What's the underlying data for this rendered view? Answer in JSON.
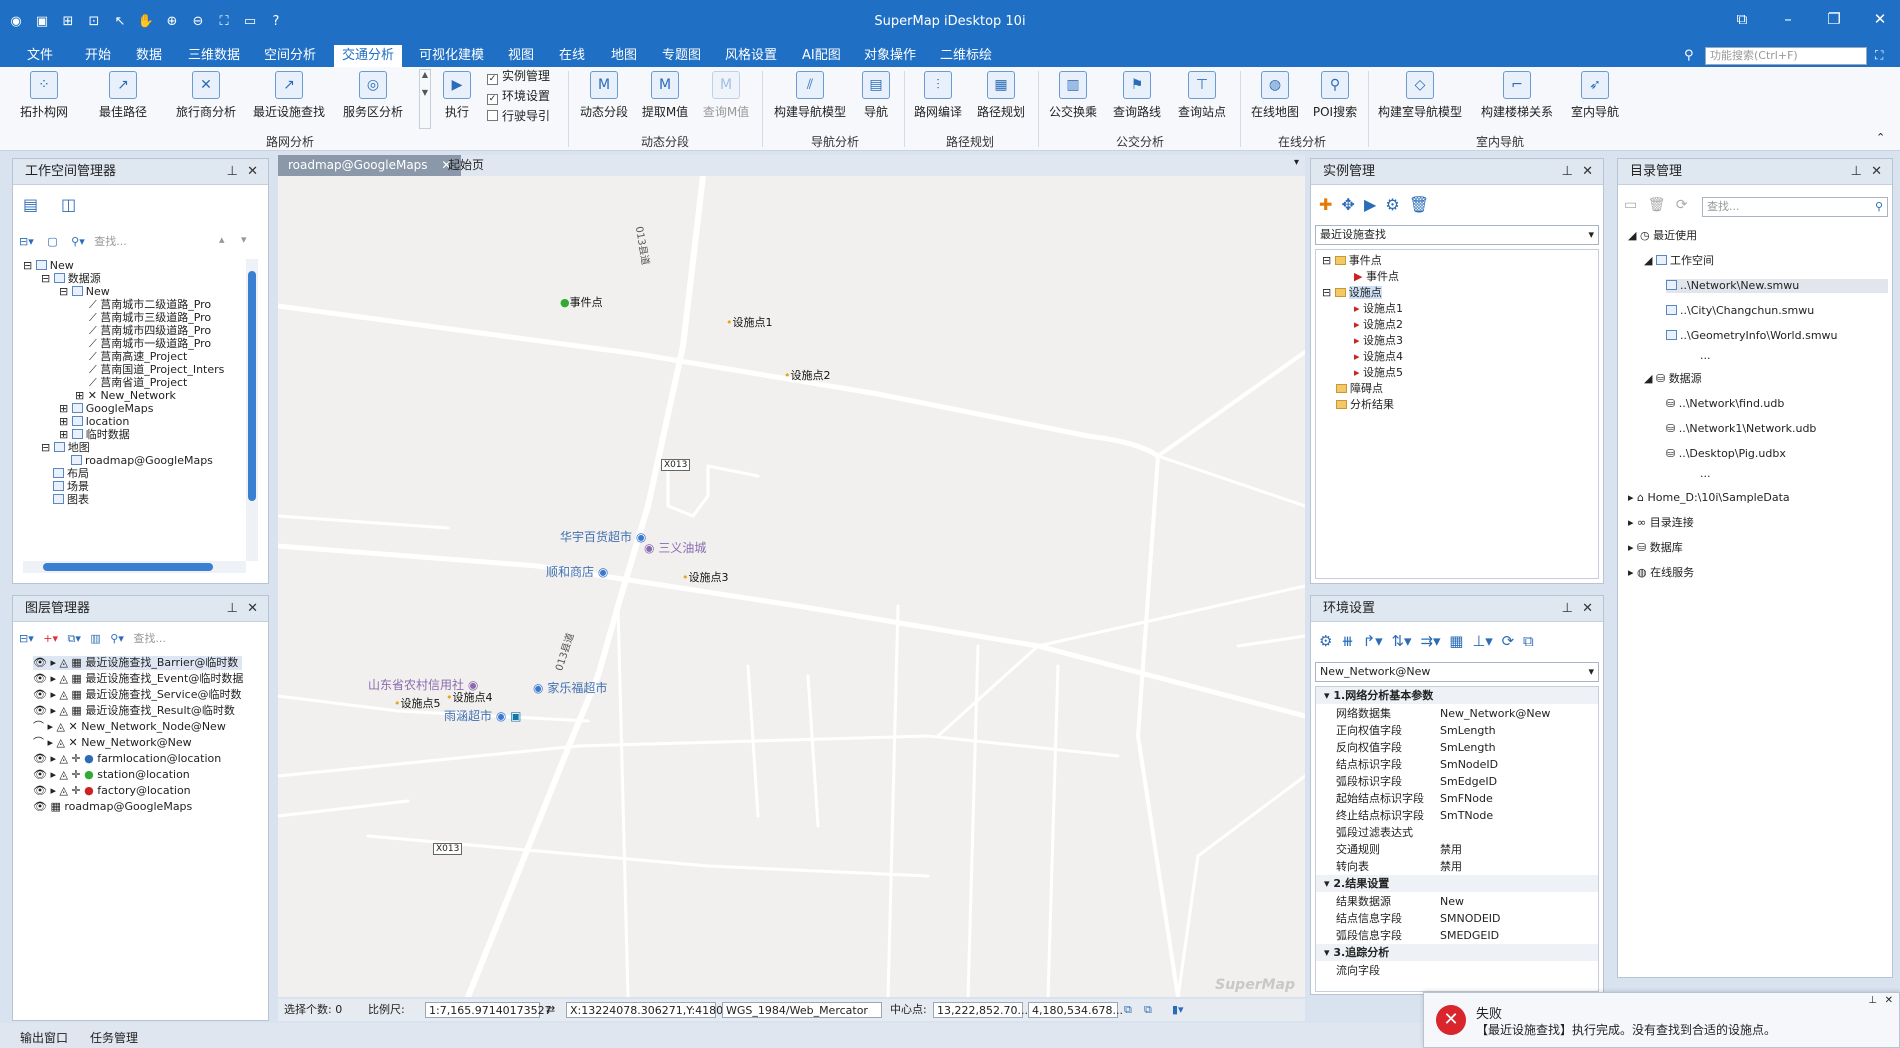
{
  "app": {
    "title": "SuperMap iDesktop 10i"
  },
  "menu": [
    "文件",
    "开始",
    "数据",
    "三维数据",
    "空间分析",
    "交通分析",
    "可视化建模",
    "视图",
    "在线",
    "地图",
    "专题图",
    "风格设置",
    "AI配图",
    "对象操作",
    "二维标绘"
  ],
  "search": {
    "placeholder": "功能搜索(Ctrl+F)"
  },
  "ribbon": {
    "buttons": [
      "拓扑构网",
      "最佳路径",
      "旅行商分析",
      "最近设施查找",
      "服务区分析",
      "执行",
      "动态分段",
      "提取M值",
      "查询M值",
      "构建导航模型",
      "导航",
      "路网编译",
      "路径规划",
      "公交换乘",
      "查询路线",
      "查询站点",
      "在线地图",
      "POI搜索",
      "构建室导航模型",
      "构建楼梯关系",
      "室内导航"
    ],
    "checks": [
      "实例管理",
      "环境设置",
      "行驶导引"
    ],
    "groups": [
      "路网分析",
      "动态分段",
      "导航分析",
      "路径规划",
      "公交分析",
      "在线分析",
      "室内导航"
    ]
  },
  "workspace": {
    "title": "工作空间管理器",
    "search_placeholder": "查找...",
    "items": [
      "New",
      "数据源",
      "New",
      "莒南城市二级道路_Pro",
      "莒南城市三级道路_Pro",
      "莒南城市四级道路_Pro",
      "莒南城市一级道路_Pro",
      "莒南高速_Project",
      "莒南国道_Project_Inters",
      "莒南省道_Project",
      "New_Network",
      "GoogleMaps",
      "location",
      "临时数据",
      "地图",
      "roadmap@GoogleMaps",
      "布局",
      "场景",
      "图表"
    ]
  },
  "layers": {
    "title": "图层管理器",
    "search_placeholder": "查找...",
    "items": [
      "最近设施查找_Barrier@临时数",
      "最近设施查找_Event@临时数据",
      "最近设施查找_Service@临时数",
      "最近设施查找_Result@临时数",
      "New_Network_Node@New",
      "New_Network@New",
      "farmlocation@location",
      "station@location",
      "factory@location",
      "roadmap@GoogleMaps"
    ]
  },
  "tabs": [
    "roadmap@GoogleMaps",
    "起始页"
  ],
  "map": {
    "labels": [
      "事件点",
      "设施点1",
      "设施点2",
      "设施点3",
      "设施点4",
      "设施点5",
      "华宇百货超市",
      "三义油城",
      "顺和商店",
      "山东省农村信用社",
      "家乐福超市",
      "雨涵超市",
      "013县道",
      "013县道",
      "X013",
      "X013"
    ],
    "watermark": "SuperMap"
  },
  "status": {
    "selected": "选择个数: 0",
    "scale_label": "比例尺:",
    "scale": "1:7,165.97140173527",
    "coords": "X:13224078.306271,Y:4180113....",
    "crs": "WGS_1984/Web_Mercator",
    "center_label": "中心点:",
    "cx": "13,222,852.70...",
    "cy": "4,180,534.678..."
  },
  "instance": {
    "title": "实例管理",
    "combo": "最近设施查找",
    "tree": [
      "事件点",
      "事件点",
      "设施点",
      "设施点1",
      "设施点2",
      "设施点3",
      "设施点4",
      "设施点5",
      "障碍点",
      "分析结果"
    ]
  },
  "env": {
    "title": "环境设置",
    "combo": "New_Network@New",
    "sections": [
      "1.网络分析基本参数",
      "2.结果设置",
      "3.追踪分析"
    ],
    "rows1": [
      [
        "网络数据集",
        "New_Network@New"
      ],
      [
        "正向权值字段",
        "SmLength"
      ],
      [
        "反向权值字段",
        "SmLength"
      ],
      [
        "结点标识字段",
        "SmNodeID"
      ],
      [
        "弧段标识字段",
        "SmEdgeID"
      ],
      [
        "起始结点标识字段",
        "SmFNode"
      ],
      [
        "终止结点标识字段",
        "SmTNode"
      ],
      [
        "弧段过滤表达式",
        ""
      ],
      [
        "交通规则",
        "禁用"
      ],
      [
        "转向表",
        "禁用"
      ]
    ],
    "rows2": [
      [
        "结果数据源",
        "New"
      ],
      [
        "结点信息字段",
        "SMNODEID"
      ],
      [
        "弧段信息字段",
        "SMEDGEID"
      ]
    ],
    "rows3": [
      [
        "流向字段",
        ""
      ]
    ]
  },
  "catalog": {
    "title": "目录管理",
    "search_placeholder": "查找...",
    "items": [
      "最近使用",
      "工作空间",
      "..\\Network\\New.smwu",
      "..\\City\\Changchun.smwu",
      "..\\GeometryInfo\\World.smwu",
      "...",
      "数据源",
      "..\\Network\\find.udb",
      "..\\Network1\\Network.udb",
      "..\\Desktop\\Pig.udbx",
      "...",
      "Home_D:\\10i\\SampleData",
      "目录连接",
      "数据库",
      "在线服务"
    ]
  },
  "bottom": [
    "输出窗口",
    "任务管理"
  ],
  "toast": {
    "title": "失败",
    "message": "【最近设施查找】执行完成。没有查找到合适的设施点。"
  },
  "colors": {
    "primary": "#1f6fc4",
    "error": "#d9262c"
  }
}
